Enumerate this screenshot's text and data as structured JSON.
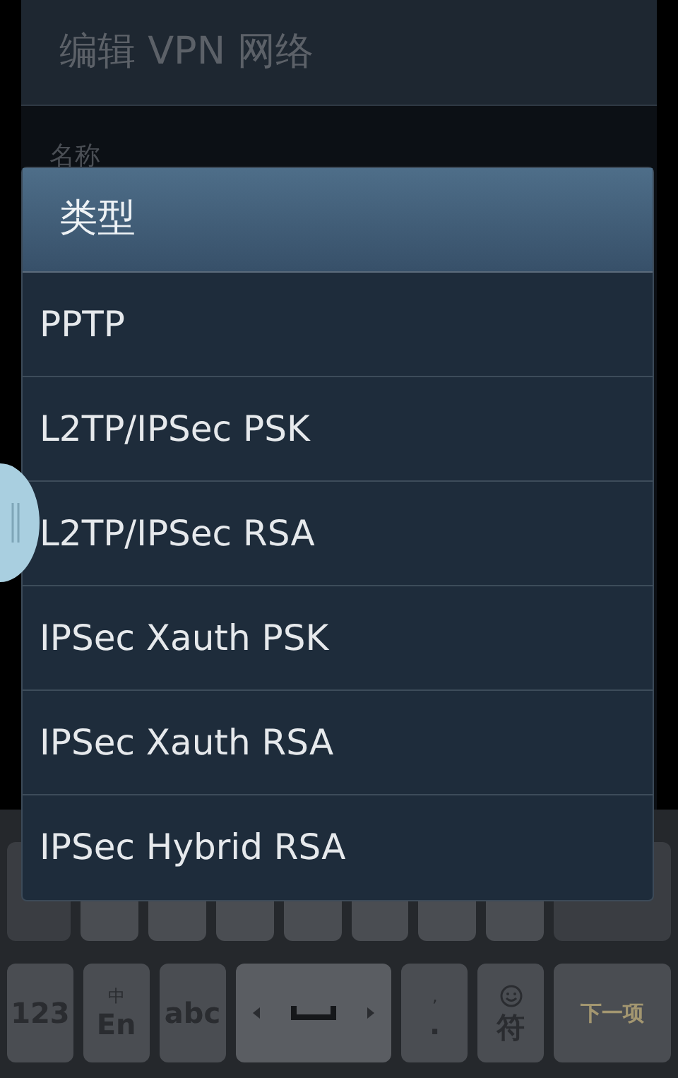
{
  "edit_dialog": {
    "title": "编辑 VPN 网络",
    "field_label": "名称"
  },
  "type_dialog": {
    "title": "类型",
    "options": [
      {
        "label": "PPTP"
      },
      {
        "label": "L2TP/IPSec PSK"
      },
      {
        "label": "L2TP/IPSec RSA"
      },
      {
        "label": "IPSec Xauth PSK"
      },
      {
        "label": "IPSec Xauth RSA"
      },
      {
        "label": "IPSec Hybrid RSA"
      }
    ]
  },
  "keyboard": {
    "bottom_row": [
      {
        "kind": "plain",
        "label": "123"
      },
      {
        "kind": "stacked",
        "top": "中",
        "label": "En"
      },
      {
        "kind": "plain",
        "label": "abc"
      },
      {
        "kind": "space"
      },
      {
        "kind": "stacked",
        "top": ",",
        "label": "."
      },
      {
        "kind": "emoji",
        "label": "符"
      },
      {
        "kind": "action",
        "label": "下一项"
      }
    ]
  }
}
